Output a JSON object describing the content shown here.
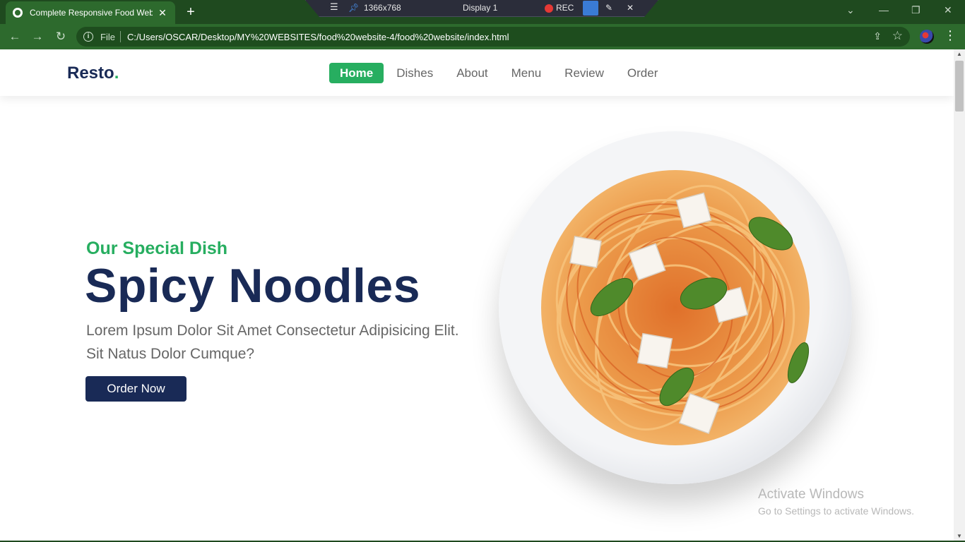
{
  "browser": {
    "tab_title": "Complete Responsive Food Website",
    "tab_close": "✕",
    "new_tab": "+",
    "url_prefix": "File",
    "url": "C:/Users/OSCAR/Desktop/MY%20WEBSITES/food%20website-4/food%20website/index.html",
    "menu": "⋮"
  },
  "recorder": {
    "resolution": "1366x768",
    "display": "Display 1",
    "rec_label": "REC"
  },
  "site": {
    "logo_text": "Resto",
    "logo_dot": ".",
    "nav": [
      "Home",
      "Dishes",
      "About",
      "Menu",
      "Review",
      "Order"
    ],
    "active_nav": "Home"
  },
  "hero": {
    "subtitle": "Our Special Dish",
    "title": "Spicy Noodles",
    "description": "Lorem Ipsum Dolor Sit Amet Consectetur Adipisicing Elit. Sit Natus Dolor Cumque?",
    "button_label": "Order Now"
  },
  "watermark": {
    "line1": "Activate Windows",
    "line2": "Go to Settings to activate Windows."
  },
  "colors": {
    "primary_green": "#27ae60",
    "dark_blue": "#192a56",
    "text_gray": "#666666",
    "browser_green": "#2d6a2d"
  },
  "icons": {
    "back": "back-arrow-icon",
    "forward": "forward-arrow-icon",
    "reload": "reload-icon",
    "info": "info-icon",
    "share": "share-icon",
    "bookmark": "star-icon",
    "extension": "extension-icon"
  }
}
